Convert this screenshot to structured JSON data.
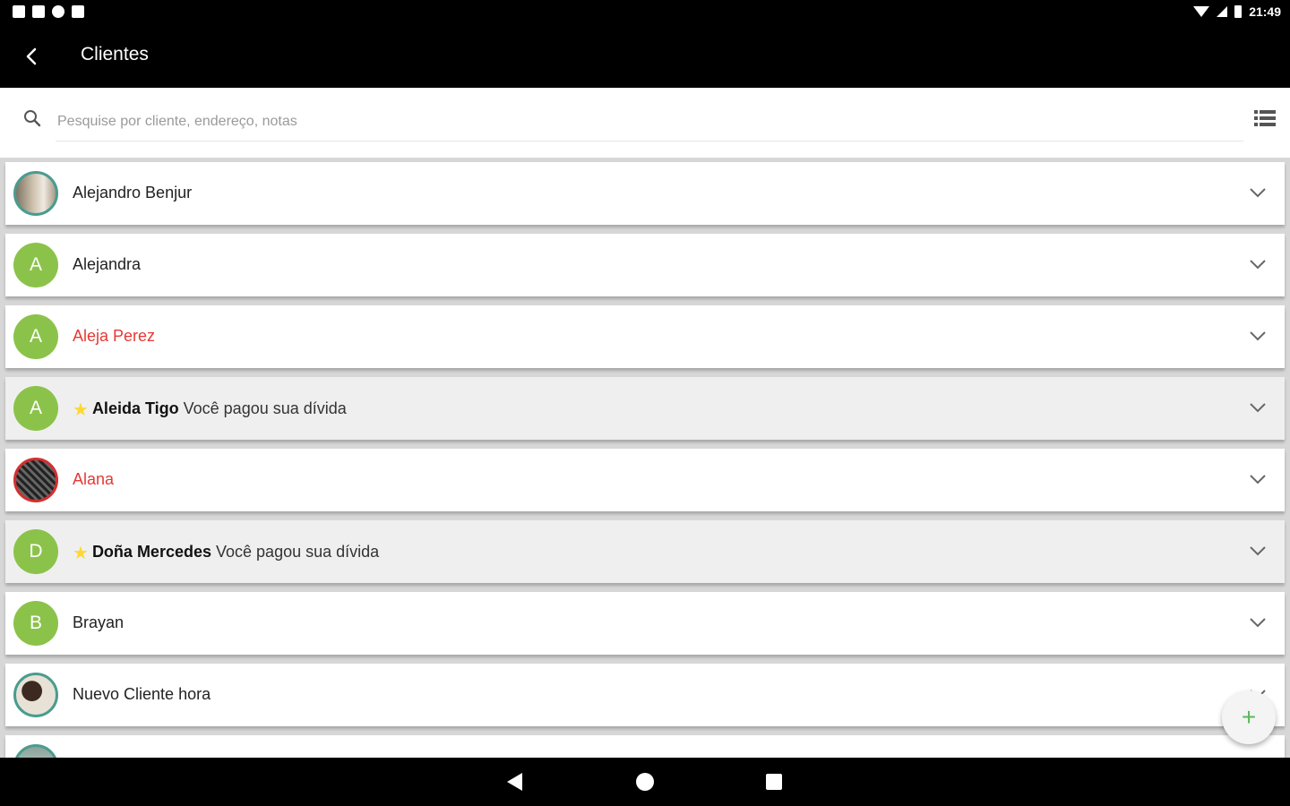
{
  "status_bar": {
    "time": "21:49"
  },
  "app_bar": {
    "title": "Clientes"
  },
  "search": {
    "placeholder": "Pesquise por cliente, endereço, notas"
  },
  "clients": [
    {
      "name": "Alejandro Benjur",
      "avatar_type": "photo"
    },
    {
      "name": "Alejandra",
      "avatar_initial": "A"
    },
    {
      "name": "Aleja Perez",
      "avatar_initial": "A",
      "name_color": "#e53935"
    },
    {
      "name": "Aleida Tigo",
      "avatar_initial": "A",
      "starred": true,
      "note": "Você pagou sua dívida"
    },
    {
      "name": "Alana",
      "avatar_type": "photo",
      "name_color": "#e53935"
    },
    {
      "name": "Doña Mercedes",
      "avatar_initial": "D",
      "starred": true,
      "note": "Você pagou sua dívida"
    },
    {
      "name": "Brayan",
      "avatar_initial": "B"
    },
    {
      "name": "Nuevo Cliente hora",
      "avatar_type": "photo"
    }
  ],
  "fab": {
    "label": "+"
  },
  "colors": {
    "initial_avatar": "#8bc34a",
    "debt_red": "#e53935",
    "star": "#fdd835",
    "fab_plus": "#5cb85c"
  },
  "icons": [
    "back-arrow-icon",
    "search-icon",
    "list-view-icon",
    "chevron-down-icon",
    "star-icon",
    "add-icon"
  ]
}
